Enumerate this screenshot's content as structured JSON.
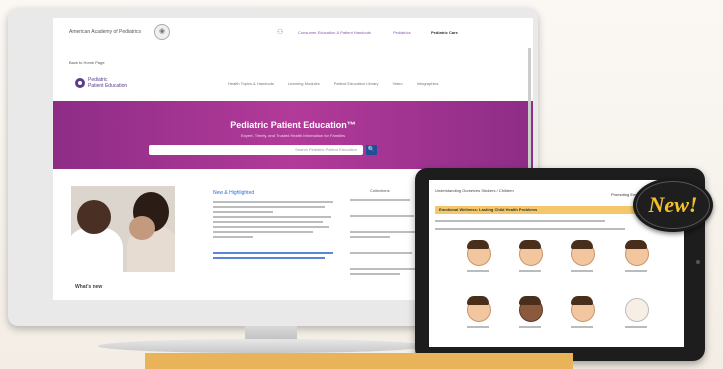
{
  "monitor": {
    "topbar": {
      "org_name": "American Academy of Pediatrics",
      "link1": "Consumer Education & Patient Handouts",
      "link2": "Pediatrics",
      "link3": "Pediatric Care"
    },
    "back_link": "Back to Home Page",
    "logo": {
      "line1": "Pediatric",
      "line2": "Patient Education"
    },
    "nav": [
      "Health Topics & Handouts",
      "Learning Modules",
      "Patient Education Library",
      "Video",
      "Infographics"
    ],
    "hero": {
      "title": "Pediatric Patient Education™",
      "subtitle": "Expert, Timely, and Trusted Health Information for Families",
      "search_placeholder": "Search Pediatric Patient Education",
      "search_button": "🔍"
    },
    "whats_new": "What's new",
    "article": {
      "heading": "New & Highlighted"
    },
    "sidebar": {
      "heading": "Collections"
    }
  },
  "tablet": {
    "header": "Understanding Ourselves Stickers / Children",
    "header_right": "Promoting Emotional Wellness",
    "band": "Emotional Wellness: Lasting Child Health Problems"
  },
  "badge": {
    "text": "New!"
  },
  "banner": {
    "text": ""
  }
}
